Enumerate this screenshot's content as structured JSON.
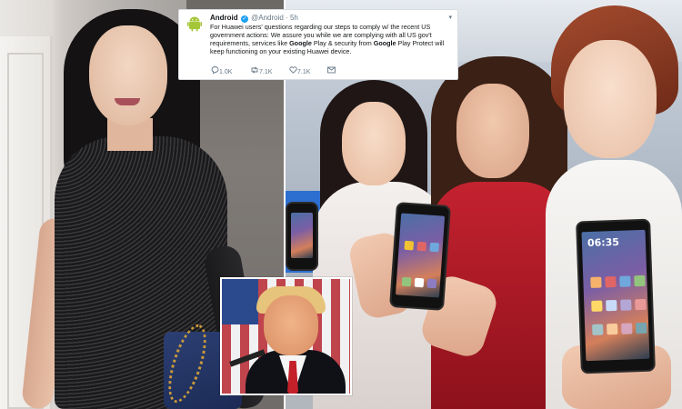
{
  "tweet": {
    "author_name": "Android",
    "author_handle": "@Android",
    "separator": "·",
    "time": "5h",
    "text_part1": "For Huawei users' questions regarding our steps to comply w/ the recent US government actions: We assure you while we are complying with all US gov't requirements, services like ",
    "bold1": "Google",
    "text_part2": " Play & security from ",
    "bold2": "Google",
    "text_part3": " Play Protect will keep functioning on your existing Huawei device.",
    "actions": {
      "replies": "1.0K",
      "retweets": "7.1K",
      "likes": "7.1K"
    },
    "icons": {
      "avatar": "android-robot-icon",
      "verified": "verified-badge-icon",
      "menu": "chevron-down-icon",
      "reply": "reply-icon",
      "retweet": "retweet-icon",
      "like": "heart-icon",
      "message": "message-icon"
    }
  },
  "phone_clock": "06:35",
  "colors": {
    "android_green": "#a4c639",
    "twitter_blue": "#1da1f2",
    "red_dress": "#c4222f"
  }
}
